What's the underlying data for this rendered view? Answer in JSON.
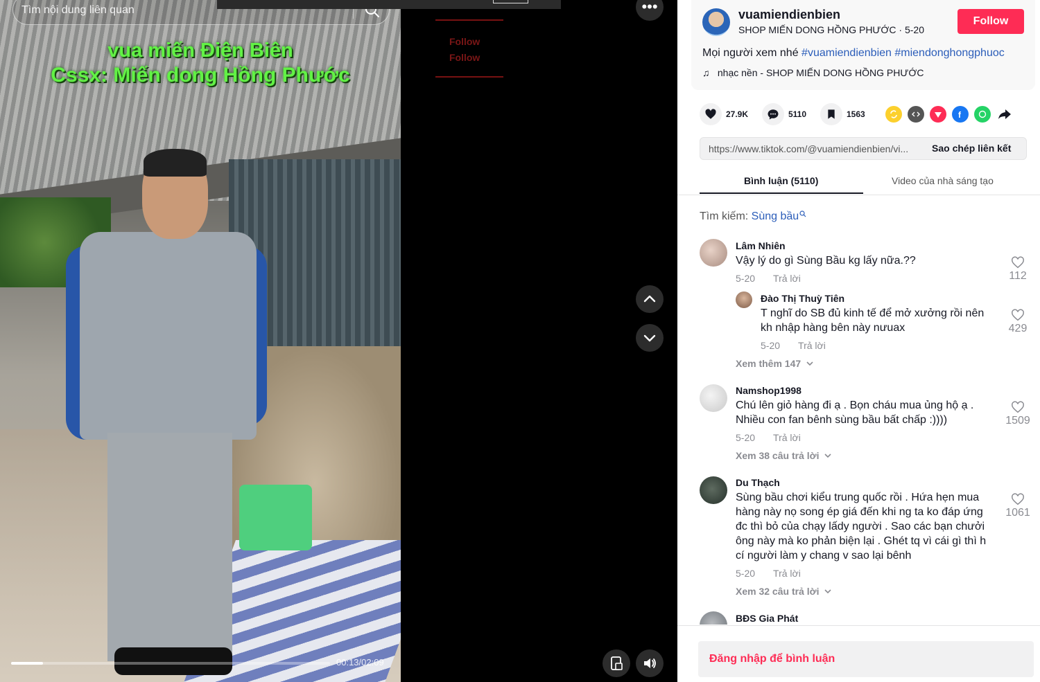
{
  "video": {
    "search_placeholder": "Tìm nội dung liên quan",
    "overlay_line1": "vua miến Điện Biên",
    "overlay_line2": "Cssx: Miến dong Hồng Phước",
    "ghost_follow": "Follow",
    "time": "00:13/02:09",
    "progress_fraction": 0.1
  },
  "author": {
    "username": "vuamiendienbien",
    "display_name": "SHOP MIẾN DONG HỒNG PHƯỚC",
    "date": "5-20",
    "follow_label": "Follow",
    "description": "Mọi người xem nhé",
    "hashtags": [
      "#vuamiendienbien",
      "#miendonghongphuoc"
    ],
    "music": "nhạc nền - SHOP MIẾN DONG HỒNG PHƯỚC"
  },
  "stats": {
    "likes": "27.9K",
    "comments": "5110",
    "saves": "1563"
  },
  "share_icons": [
    "repost-icon",
    "embed-icon",
    "send-icon",
    "facebook-icon",
    "whatsapp-icon",
    "share-arrow-icon"
  ],
  "link": {
    "url": "https://www.tiktok.com/@vuamiendienbien/vi...",
    "copy_label": "Sao chép liên kết"
  },
  "tabs": {
    "comments": "Bình luận (5110)",
    "creator_videos": "Video của nhà sáng tạo"
  },
  "search_hint": {
    "label": "Tìm kiếm:",
    "keyword": "Sùng bầu"
  },
  "comments": [
    {
      "user": "Lâm Nhiên",
      "text": "Vậy lý do gì Sùng Bầu kg lấy nữa.??",
      "date": "5-20",
      "reply": "Trả lời",
      "likes": "112",
      "replies": [
        {
          "user": "Đào Thị Thuỳ Tiên",
          "text": "T nghĩ do SB đủ kinh tế để mở xưởng rồi nên kh nhập hàng bên này nưuax",
          "date": "5-20",
          "reply": "Trả lời",
          "likes": "429"
        }
      ],
      "more": "Xem thêm 147"
    },
    {
      "user": "Namshop1998",
      "text": "Chú lên giỏ hàng đi ạ . Bọn cháu mua ủng hộ ạ . Nhiều con fan bênh sùng bầu bất chấp :))))",
      "date": "5-20",
      "reply": "Trả lời",
      "likes": "1509",
      "more": "Xem 38 câu trả lời"
    },
    {
      "user": "Du Thạch",
      "text": "Sùng bầu chơi kiểu trung quốc rồi . Hứa hẹn mua hàng này nọ song ép giá đến khi ng ta ko đáp ứng đc thì bỏ của chạy lấdy người . Sao các bạn chưởi ông này mà ko phản biện lại . Ghét tq vì cái gì thì h cí người làm y chang v sao lại bênh",
      "date": "5-20",
      "reply": "Trả lời",
      "likes": "1061",
      "more": "Xem 32 câu trả lời"
    },
    {
      "user": "BĐS Gia Phát"
    }
  ],
  "login_label": "Đăng nhập để bình luận",
  "colors": {
    "accent": "#fe2c55",
    "hashtag": "#2b5db9",
    "overlay_text": "#62f245"
  }
}
